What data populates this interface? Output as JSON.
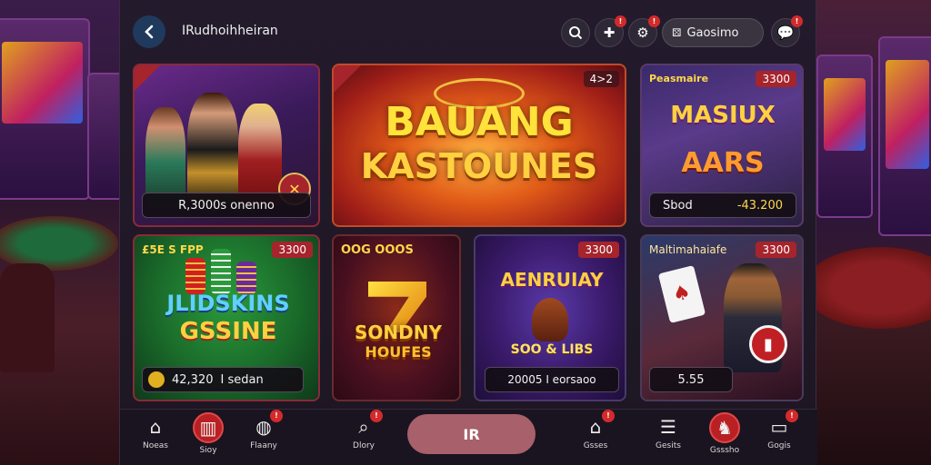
{
  "header": {
    "title": "IRudhoihheiran",
    "back_icon": "chevron-left-icon",
    "casino_label": "Gaosimo",
    "badges": {
      "share": "!",
      "settings": "!",
      "chat": "!"
    }
  },
  "cards": {
    "promo_girls": {
      "footer": "R,3000s onenno"
    },
    "featured": {
      "logo_line1": "BAUANG",
      "logo_line2": "KASTOUNES",
      "tag": "4>2"
    },
    "masiux": {
      "name": "Peasmaire",
      "tag": "3300",
      "logo_line1": "MASIUX",
      "logo_line2": "AARS",
      "footer_left": "Sbod",
      "footer_right": "-43.200"
    },
    "jlidskins": {
      "name": "£5E S FPP",
      "tag": "3300",
      "logo_line1": "JLIDSKINS",
      "logo_line2": "GSSINE",
      "footer_value": "42,320",
      "footer_text": "I sedan"
    },
    "sondny": {
      "name": "OOG OOOS",
      "logo_line1": "SONDNY",
      "logo_line2": "HOUFES"
    },
    "aenruiay": {
      "tag": "3300",
      "logo": "AENRUIAY",
      "subline": "SOO & LIBS",
      "footer": "20005 I eorsaoo"
    },
    "maltimahaie": {
      "name": "Maltimahaiafe",
      "tag": "3300",
      "footer": "5.55"
    }
  },
  "nav": {
    "items": [
      {
        "label": "Noeas",
        "icon": "home-icon"
      },
      {
        "label": "Sioy",
        "icon": "slots-icon"
      },
      {
        "label": "Flaany",
        "icon": "globe-icon"
      },
      {
        "label": "Dlory",
        "icon": "search-icon"
      },
      {
        "label": "Gsses",
        "icon": "shop-icon"
      },
      {
        "label": "Gesits",
        "icon": "stack-icon"
      },
      {
        "label": "Gsssho",
        "icon": "horse-icon"
      },
      {
        "label": "Gogis",
        "icon": "bus-icon"
      }
    ],
    "center_label": "IR",
    "badge": "!"
  },
  "colors": {
    "accent_red": "#a6242c",
    "gold": "#ffd84a"
  }
}
